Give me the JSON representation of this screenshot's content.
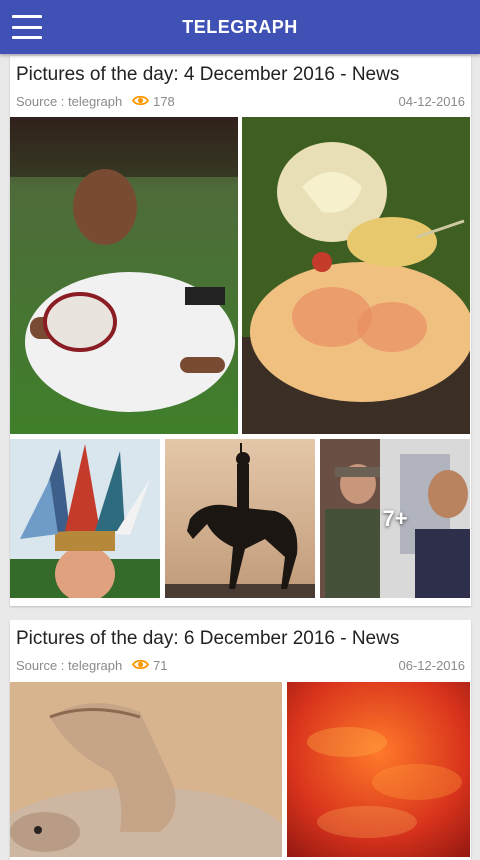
{
  "app": {
    "title": "TELEGRAPH"
  },
  "posts": [
    {
      "title": "Pictures of the day: 4 December 2016 - News",
      "source": "Source : telegraph",
      "views": "178",
      "date": "04-12-2016",
      "images": [
        {
          "label": "rugby-player-photo"
        },
        {
          "label": "frog-and-snail-photo"
        },
        {
          "label": "feather-headdress-photo"
        },
        {
          "label": "horse-rider-silhouette-photo"
        },
        {
          "label": "doorstep-photo",
          "more": "7+"
        }
      ]
    },
    {
      "title": "Pictures of the day: 6 December 2016 - News",
      "source": "Source : telegraph",
      "views": "71",
      "date": "06-12-2016",
      "images": [
        {
          "label": "seal-photo"
        },
        {
          "label": "red-sky-photo"
        }
      ]
    }
  ],
  "colors": {
    "appbar": "#3f51b5",
    "eye_icon": "#ff9800"
  }
}
